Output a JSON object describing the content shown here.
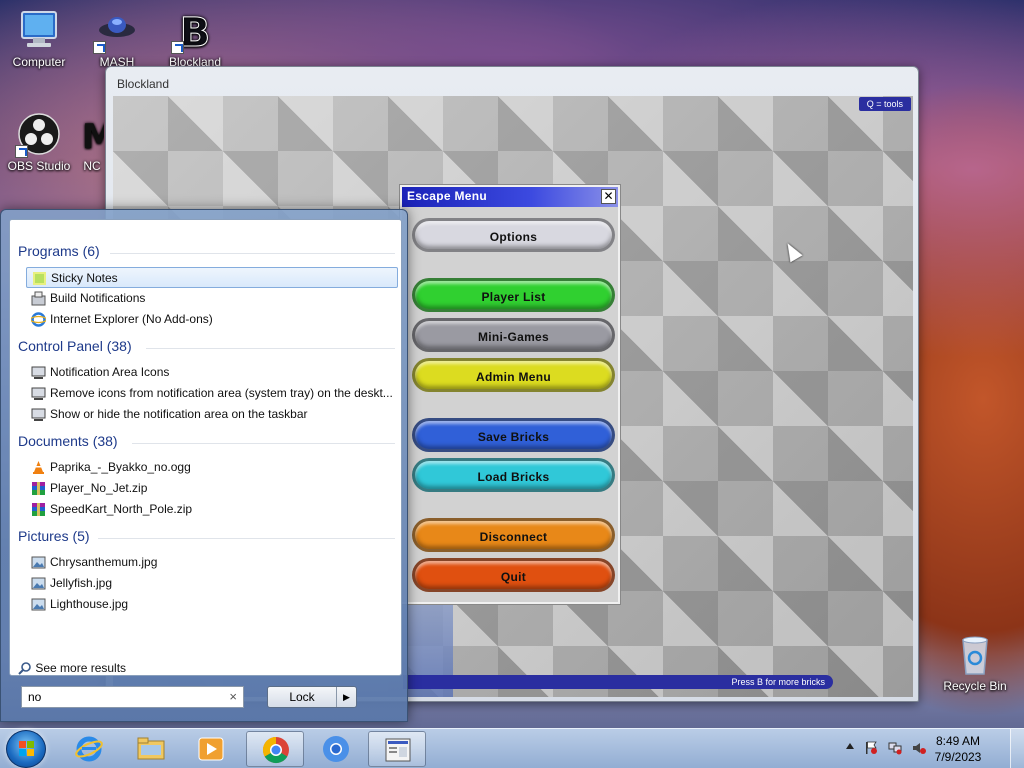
{
  "desktop": {
    "icons": [
      {
        "label": "Computer"
      },
      {
        "label": "MASH"
      },
      {
        "label": "Blockland"
      },
      {
        "label": "OBS Studio"
      },
      {
        "label": "NC"
      },
      {
        "label": "Recycle Bin"
      }
    ]
  },
  "window": {
    "title": "Blockland",
    "hint_top": "Q = tools",
    "hint_bottom": "Press B for more bricks"
  },
  "escape_menu": {
    "title": "Escape Menu",
    "close_glyph": "✕",
    "buttons": [
      {
        "label": "Options",
        "color": "#d8d8e0"
      },
      {
        "label": "Player List",
        "color": "#30d030"
      },
      {
        "label": "Mini-Games",
        "color": "#9a9aa2"
      },
      {
        "label": "Admin Menu",
        "color": "#dcdc20"
      },
      {
        "label": "Save Bricks",
        "color": "#3060d8"
      },
      {
        "label": "Load Bricks",
        "color": "#30c8d8"
      },
      {
        "label": "Disconnect",
        "color": "#e88818"
      },
      {
        "label": "Quit",
        "color": "#e05010"
      }
    ]
  },
  "start_menu": {
    "sections": [
      {
        "heading": "Programs (6)",
        "items": [
          {
            "label": "Sticky Notes",
            "icon": "sticky-notes-icon",
            "selected": true
          },
          {
            "label": "Build Notifications",
            "icon": "build-notifications-icon"
          },
          {
            "label": "Internet Explorer (No Add-ons)",
            "icon": "internet-explorer-icon"
          }
        ]
      },
      {
        "heading": "Control Panel (38)",
        "items": [
          {
            "label": "Notification Area Icons",
            "icon": "control-panel-icon"
          },
          {
            "label": "Remove icons from notification area (system tray) on the deskt...",
            "icon": "control-panel-icon"
          },
          {
            "label": "Show or hide the notification area on the taskbar",
            "icon": "control-panel-icon"
          }
        ]
      },
      {
        "heading": "Documents (38)",
        "items": [
          {
            "label": "Paprika_-_Byakko_no.ogg",
            "icon": "vlc-cone-icon"
          },
          {
            "label": "Player_No_Jet.zip",
            "icon": "winrar-archive-icon"
          },
          {
            "label": "SpeedKart_North_Pole.zip",
            "icon": "winrar-archive-icon"
          }
        ]
      },
      {
        "heading": "Pictures (5)",
        "items": [
          {
            "label": "Chrysanthemum.jpg",
            "icon": "image-file-icon"
          },
          {
            "label": "Jellyfish.jpg",
            "icon": "image-file-icon"
          },
          {
            "label": "Lighthouse.jpg",
            "icon": "image-file-icon"
          }
        ]
      }
    ],
    "see_more": "See more results",
    "search_value": "no",
    "search_clear": "×",
    "lock_label": "Lock",
    "lock_arrow": "▶"
  },
  "taskbar": {
    "pinned": [
      {
        "name": "internet-explorer",
        "open": false
      },
      {
        "name": "file-explorer",
        "open": false
      },
      {
        "name": "media-player",
        "open": false
      },
      {
        "name": "chrome",
        "open": true
      },
      {
        "name": "chrome-beta",
        "open": false
      },
      {
        "name": "blockland",
        "open": true
      }
    ],
    "clock_time": "8:49 AM",
    "clock_date": "7/9/2023"
  }
}
